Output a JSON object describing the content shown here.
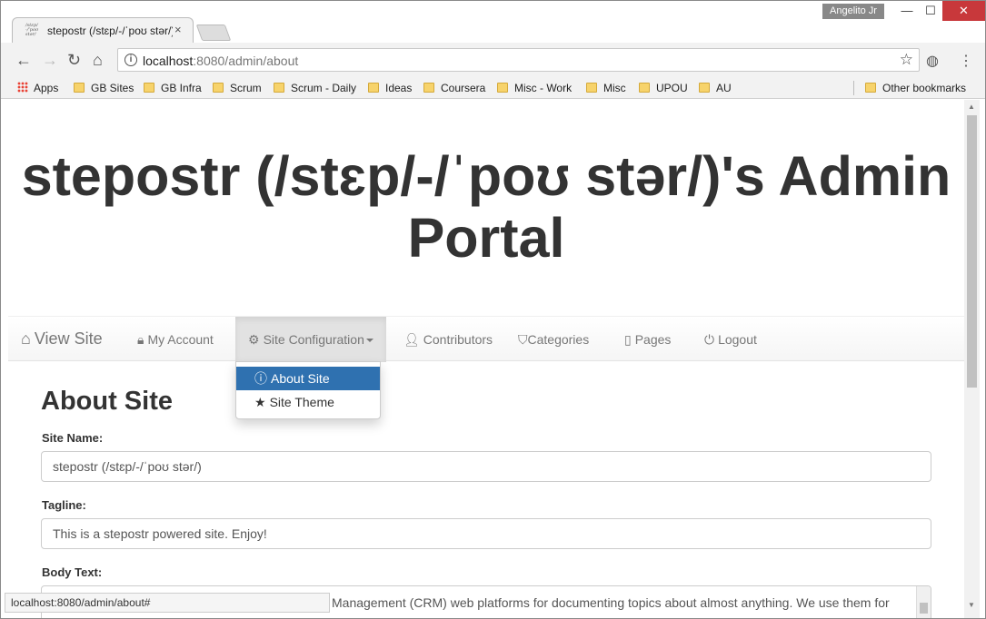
{
  "browser": {
    "tab_title": "stepostr (/stɛp/-/ˈpoʊ stər/)'s Admin Portal",
    "tab_favicon_text": "/stɛp/ -/ˈpoʊ stər/",
    "tab_close": "×",
    "user_name": "Angelito Jr",
    "window_controls": {
      "minimize": "—",
      "maximize": "☐",
      "close": "✕"
    },
    "url_host": "localhost",
    "url_path": ":8080/admin/about",
    "status_url": "localhost:8080/admin/about#"
  },
  "bookmarks": {
    "apps_label": "Apps",
    "items": [
      "GB Sites",
      "GB Infra",
      "Scrum",
      "Scrum - Daily",
      "Ideas",
      "Coursera",
      "Misc - Work",
      "Misc",
      "UPOU",
      "AU"
    ],
    "other_label": "Other bookmarks"
  },
  "page": {
    "title": "stepostr (/stɛp/-/ˈpoʊ stər/)'s Admin Portal"
  },
  "navbar": {
    "brand": "View Site",
    "items": {
      "my_account": "My Account",
      "site_config": "Site Configuration",
      "contributors": "Contributors",
      "categories": "Categories",
      "pages": "Pages",
      "logout": "Logout"
    }
  },
  "dropdown": {
    "about_site": "About Site",
    "site_theme": "Site Theme"
  },
  "form": {
    "heading": "About Site",
    "site_name_label": "Site Name:",
    "site_name_value": "stepostr (/stɛp/-/ˈpoʊ stər/)",
    "tagline_label": "Tagline:",
    "tagline_value": "This is a stepostr powered site. Enjoy!",
    "body_label": "Body Text:",
    "body_value": "Management (CRM) web platforms for documenting topics about almost anything. We use them for"
  }
}
